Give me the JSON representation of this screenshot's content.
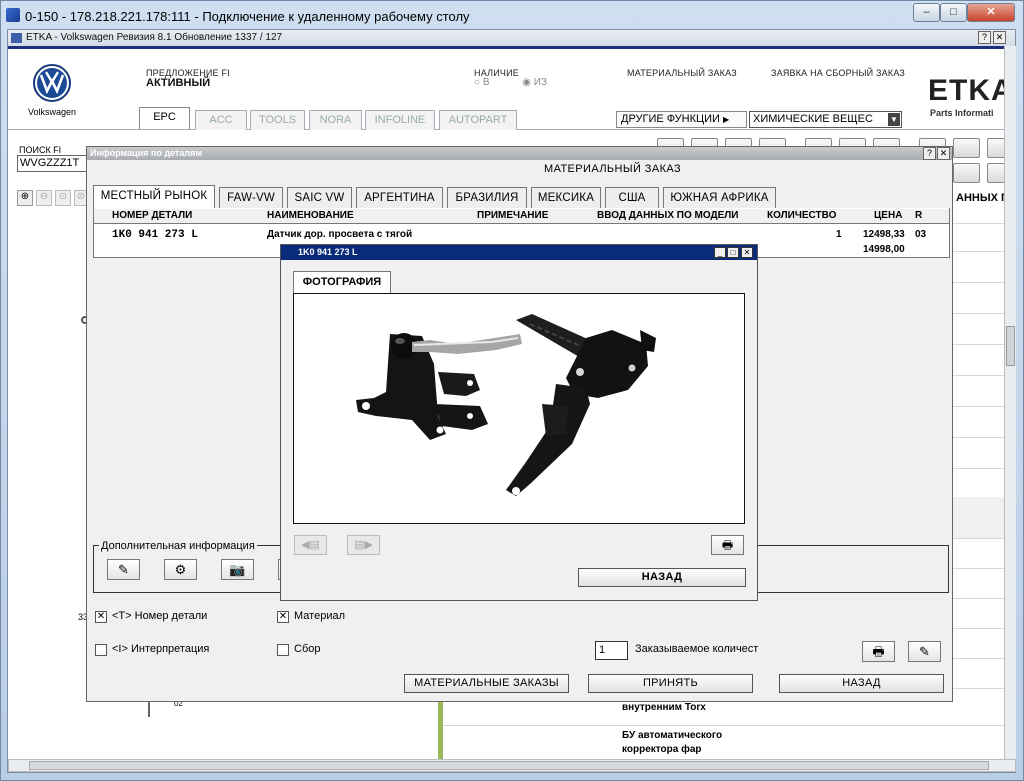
{
  "rdp": {
    "title": "0-150 - 178.218.221.178:111 - Подключение к удаленному рабочему столу",
    "min": "–",
    "max": "□",
    "close": "✕"
  },
  "etka": {
    "title": "ETKA - Volkswagen Ревизия 8.1 Обновление 1337 / 127",
    "help": "?",
    "close": "✕",
    "brand": "Volkswagen",
    "offer_label": "ПРЕДЛОЖЕНИЕ FI",
    "offer_value": "АКТИВНЫЙ",
    "avail_label": "НАЛИЧИЕ",
    "avail_b": "В",
    "avail_iz": "ИЗ",
    "mat_order": "МАТЕРИАЛЬНЫЙ ЗАКАЗ",
    "assembly_order": "ЗАЯВКА НА СБОРНЫЙ ЗАКАЗ",
    "logo": "ETKA",
    "logo_sub": "Parts Informati",
    "other_functions": "ДРУГИЕ ФУНКЦИИ",
    "chem_select": "ХИМИЧЕСКИЕ ВЕЩЕС",
    "search_label": "ПОИСК FI",
    "search_value": "WVGZZZ1T",
    "right_header": "АННЫХ П",
    "tabs": [
      "EPC",
      "ACC",
      "TOOLS",
      "NORA",
      "INFOLINE",
      "AUTOPART"
    ],
    "bg_number": "33",
    "bg_small": "02",
    "bg_row1": "внутренним Torx",
    "bg_row2a": "БУ автоматического",
    "bg_row2b": "корректора фар",
    "colors": {
      "title_blue": "#1b2f7c",
      "accent_green": "#9aba5a"
    }
  },
  "dialog": {
    "title": "Информация по деталям",
    "heading": "МАТЕРИАЛЬНЫЙ ЗАКАЗ",
    "help": "?",
    "close": "✕",
    "tabs": [
      "МЕСТНЫЙ РЫНОК",
      "FAW-VW",
      "SAIC VW",
      "АРГЕНТИНА",
      "БРАЗИЛИЯ",
      "МЕКСИКА",
      "США",
      "ЮЖНАЯ АФРИКА"
    ],
    "columns": [
      "НОМЕР ДЕТАЛИ",
      "НАИМЕНОВАНИЕ",
      "ПРИМЕЧАНИЕ",
      "ВВОД ДАННЫХ ПО МОДЕЛИ",
      "КОЛИЧЕСТВО",
      "ЦЕНА",
      "R"
    ],
    "row": {
      "part": "1K0 941 273 L",
      "name": "Датчик дор. просвета с тягой",
      "qty": "1",
      "price1": "12498,33",
      "price2": "14998,00",
      "r": "03"
    },
    "additional_info": "Дополнительная информация",
    "cb_part_number": "<T> Номер детали",
    "cb_material": "Материал",
    "cb_interpretation": "<I> Интерпретация",
    "cb_assembly": "Сбор",
    "order_qty_value": "1",
    "order_qty_label": "Заказываемое количест",
    "btn_mat_orders": "МАТЕРИАЛЬНЫЕ ЗАКАЗЫ",
    "btn_accept": "ПРИНЯТЬ",
    "btn_back": "НАЗАД"
  },
  "photo": {
    "title": "1K0 941 273 L",
    "tab": "ФОТОГРАФИЯ",
    "btn_back": "НАЗАД"
  }
}
